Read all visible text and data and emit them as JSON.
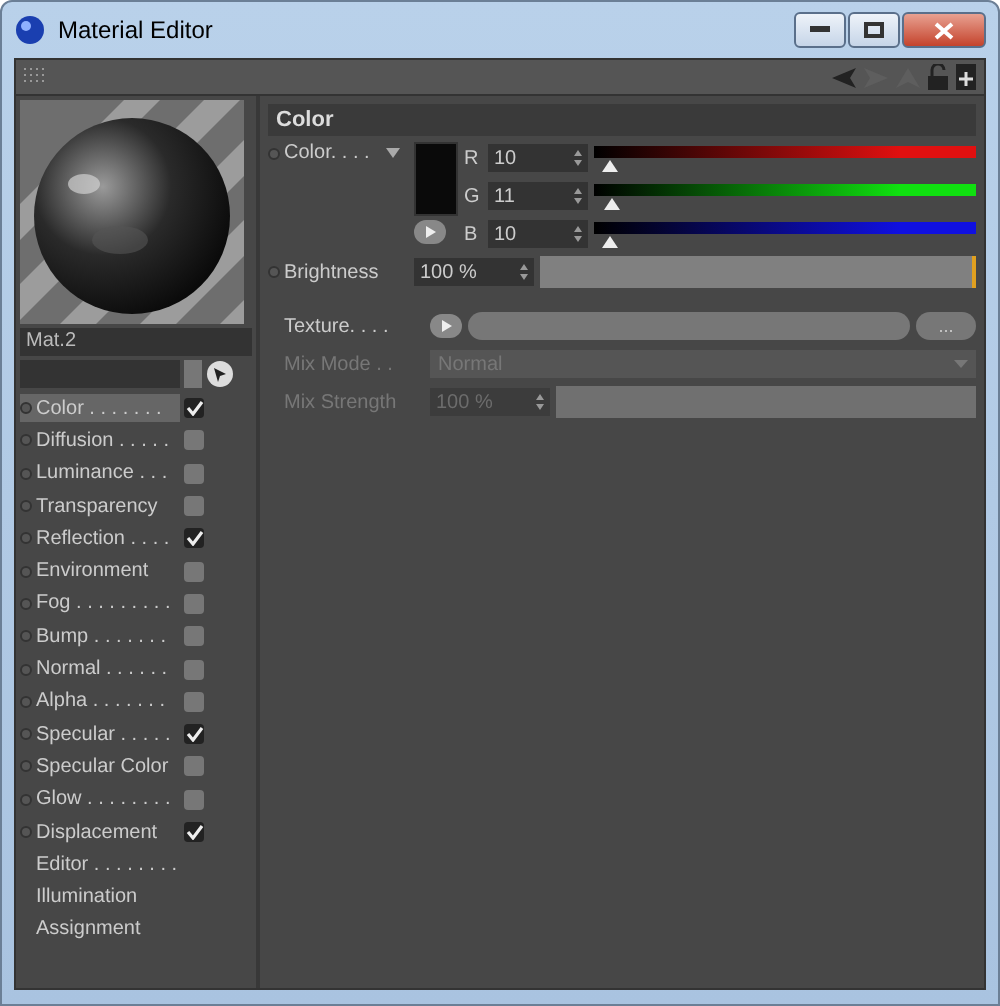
{
  "window": {
    "title": "Material Editor"
  },
  "material": {
    "name": "Mat.2"
  },
  "channels": [
    {
      "label": "Color . . . . . . .",
      "kind": "checkbox",
      "checked": true,
      "selected": true
    },
    {
      "label": "Diffusion . . . . .",
      "kind": "checkbox",
      "checked": false,
      "selected": false
    },
    {
      "label": "Luminance . . .",
      "kind": "checkbox",
      "checked": false,
      "selected": false
    },
    {
      "label": "Transparency",
      "kind": "checkbox",
      "checked": false,
      "selected": false
    },
    {
      "label": "Reflection . . . .",
      "kind": "checkbox",
      "checked": true,
      "selected": false
    },
    {
      "label": "Environment",
      "kind": "checkbox",
      "checked": false,
      "selected": false
    },
    {
      "label": "Fog . . . . . . . . .",
      "kind": "checkbox",
      "checked": false,
      "selected": false
    },
    {
      "label": "Bump . . . . . . .",
      "kind": "checkbox",
      "checked": false,
      "selected": false
    },
    {
      "label": "Normal . . . . . .",
      "kind": "checkbox",
      "checked": false,
      "selected": false
    },
    {
      "label": "Alpha . . . . . . .",
      "kind": "checkbox",
      "checked": false,
      "selected": false
    },
    {
      "label": "Specular . . . . .",
      "kind": "checkbox",
      "checked": true,
      "selected": false
    },
    {
      "label": "Specular Color",
      "kind": "checkbox",
      "checked": false,
      "selected": false
    },
    {
      "label": "Glow . . . . . . . .",
      "kind": "checkbox",
      "checked": false,
      "selected": false
    },
    {
      "label": "Displacement",
      "kind": "checkbox",
      "checked": true,
      "selected": false
    },
    {
      "label": "Editor . . . . . . . .",
      "kind": "plain",
      "selected": false
    },
    {
      "label": "Illumination",
      "kind": "plain",
      "selected": false
    },
    {
      "label": "Assignment",
      "kind": "plain",
      "selected": false
    }
  ],
  "section": {
    "title": "Color"
  },
  "color": {
    "label": "Color. . . .",
    "components": [
      {
        "letter": "R",
        "value": "10",
        "level": 0.04,
        "color": "#e01010"
      },
      {
        "letter": "G",
        "value": "11",
        "level": 0.045,
        "color": "#10e010"
      },
      {
        "letter": "B",
        "value": "10",
        "level": 0.04,
        "color": "#1010e0"
      }
    ]
  },
  "brightness": {
    "label": "Brightness",
    "value": "100 %",
    "level": 1
  },
  "texture": {
    "label": "Texture. . . .",
    "button": "..."
  },
  "mix_mode": {
    "label": "Mix Mode . .",
    "value": "Normal",
    "disabled": true
  },
  "mix_strength": {
    "label": "Mix Strength",
    "value": "100 %",
    "level": 1,
    "disabled": true
  }
}
